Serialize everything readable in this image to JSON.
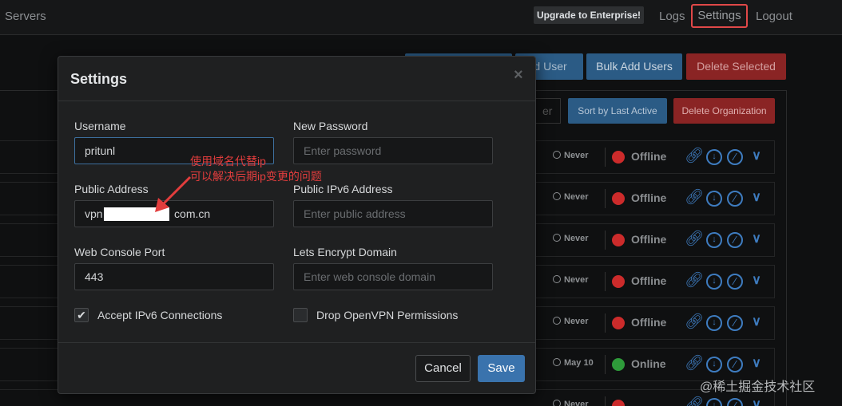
{
  "topbar": {
    "brand": "Servers",
    "upgrade": "Upgrade to Enterprise!",
    "nav": {
      "logs": "Logs",
      "settings": "Settings",
      "logout": "Logout"
    }
  },
  "background": {
    "buttons": {
      "add_user": "ld User",
      "bulk_add": "Bulk Add Users",
      "delete_selected": "Delete Selected"
    },
    "filter_partial": "er",
    "sort": "Sort by Last Active",
    "delete_org": "Delete Organization",
    "users": [
      {
        "last_active": "Never",
        "status": "Offline",
        "status_color": "#cc2b2b"
      },
      {
        "last_active": "Never",
        "status": "Offline",
        "status_color": "#cc2b2b"
      },
      {
        "last_active": "Never",
        "status": "Offline",
        "status_color": "#cc2b2b"
      },
      {
        "last_active": "Never",
        "status": "Offline",
        "status_color": "#cc2b2b"
      },
      {
        "last_active": "Never",
        "status": "Offline",
        "status_color": "#cc2b2b"
      },
      {
        "last_active": "May 10",
        "status": "Online",
        "status_color": "#2e9b3a"
      },
      {
        "last_active": "Never",
        "status": "",
        "status_color": "#cc2b2b"
      }
    ]
  },
  "modal": {
    "title": "Settings",
    "close": "×",
    "fields": {
      "username": {
        "label": "Username",
        "value": "pritunl"
      },
      "new_password": {
        "label": "New Password",
        "placeholder": "Enter password"
      },
      "public_address": {
        "label": "Public Address",
        "value": "vpn                       com.cn"
      },
      "public_ipv6": {
        "label": "Public IPv6 Address",
        "placeholder": "Enter public address"
      },
      "web_console_port": {
        "label": "Web Console Port",
        "value": "443"
      },
      "lets_encrypt": {
        "label": "Lets Encrypt Domain",
        "placeholder": "Enter web console domain"
      }
    },
    "checkboxes": {
      "accept_ipv6": {
        "label": "Accept IPv6 Connections",
        "checked": true
      },
      "drop_openvpn": {
        "label": "Drop OpenVPN Permissions",
        "checked": false
      }
    },
    "buttons": {
      "cancel": "Cancel",
      "save": "Save"
    }
  },
  "annotation": {
    "line1": "使用域名代替ip",
    "line2": "可以解决后期ip变更的问题",
    "color": "#e23d3d"
  },
  "watermark": "@稀土掘金技术社区"
}
